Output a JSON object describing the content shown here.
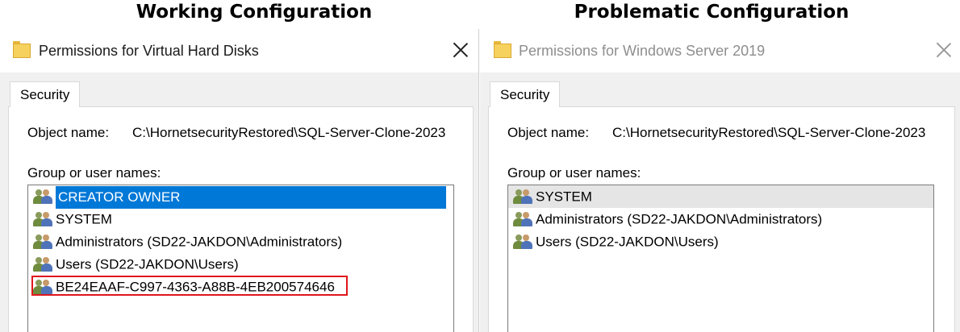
{
  "headings": {
    "left": "Working Configuration",
    "right": "Problematic Configuration"
  },
  "left_window": {
    "title": "Permissions for Virtual Hard Disks",
    "tab": "Security",
    "object_name_label": "Object name:",
    "object_name_value": "C:\\HornetsecurityRestored\\SQL-Server-Clone-2023",
    "group_label": "Group or user names:",
    "users": [
      "CREATOR OWNER",
      "SYSTEM",
      "Administrators (SD22-JAKDON\\Administrators)",
      "Users (SD22-JAKDON\\Users)",
      "BE24EAAF-C997-4363-A88B-4EB200574646"
    ]
  },
  "right_window": {
    "title": "Permissions for Windows Server 2019",
    "tab": "Security",
    "object_name_label": "Object name:",
    "object_name_value": "C:\\HornetsecurityRestored\\SQL-Server-Clone-2023",
    "group_label": "Group or user names:",
    "users": [
      "SYSTEM",
      "Administrators (SD22-JAKDON\\Administrators)",
      "Users (SD22-JAKDON\\Users)"
    ]
  },
  "icons": {
    "folder": "folder-icon",
    "close": "close-icon",
    "user": "user-group-icon"
  },
  "colors": {
    "selection": "#0078d7",
    "highlight_box": "#e0161c"
  }
}
